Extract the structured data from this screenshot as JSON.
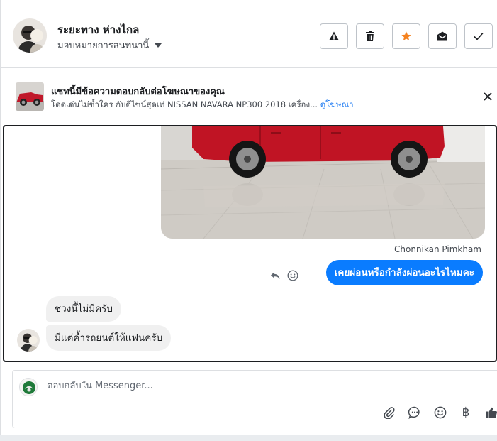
{
  "header": {
    "contact_name": "ระยะทาง ห่างไกล",
    "assign_label": "มอบหมายการสนทนานี้",
    "actions": [
      "spam-icon",
      "trash-icon",
      "star-icon",
      "mark-unread-icon",
      "done-icon"
    ],
    "star_color": "#f5821f"
  },
  "ad_banner": {
    "title": "แชทนี้มีข้อความตอบกลับต่อโฆษณาของคุณ",
    "subtitle": "โดดเด่นไม่ซ้ำใคร กับดีไซน์สุดเท่ NISSAN NAVARA NP300 2018 เครื่อง...",
    "link": "ดูโฆษณา"
  },
  "conversation": {
    "sender_name": "Chonnikan Pimkham",
    "outgoing_message": "เคยผ่อนหรือกำลังผ่อนอะไรไหมคะ",
    "incoming_messages": [
      "ช่วงนี้ไม่มีครับ",
      "มีแต่ค้ำรถยนต์ให้แฟนครับ"
    ],
    "bubble_color_out": "#0a7cff",
    "bubble_color_in": "#f0f0f0"
  },
  "reply": {
    "placeholder": "ตอบกลับใน Messenger...",
    "baht_symbol": "฿"
  }
}
